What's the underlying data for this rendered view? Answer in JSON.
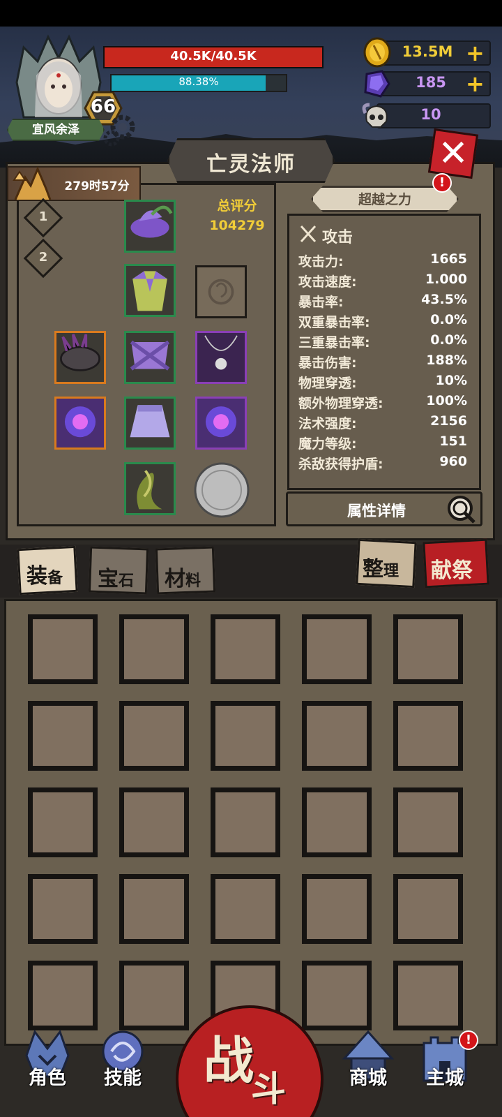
{
  "player": {
    "name": "宜风余泽",
    "level": "66",
    "hp_text": "40.5K/40.5K",
    "hp_fraction": 1.0,
    "exp_text": "88.38%",
    "exp_fraction": 0.8838
  },
  "resources": {
    "gold": "13.5M",
    "crystal": "185",
    "skull_token": "10"
  },
  "title": "亡灵法师",
  "timer": "279时57分",
  "presets": [
    "1",
    "2"
  ],
  "score": {
    "label": "总评分",
    "value": "104279"
  },
  "beyond_power": "超越之力",
  "stats": {
    "header": "攻击",
    "rows": [
      {
        "name": "攻击力:",
        "value": "1665"
      },
      {
        "name": "攻击速度:",
        "value": "1.000"
      },
      {
        "name": "暴击率:",
        "value": "43.5%"
      },
      {
        "name": "双重暴击率:",
        "value": "0.0%"
      },
      {
        "name": "三重暴击率:",
        "value": "0.0%"
      },
      {
        "name": "暴击伤害:",
        "value": "188%"
      },
      {
        "name": "物理穿透:",
        "value": "10%"
      },
      {
        "name": "额外物理穿透:",
        "value": "100%"
      },
      {
        "name": "法术强度:",
        "value": "2156"
      },
      {
        "name": "魔力等级:",
        "value": "151"
      },
      {
        "name": "杀敌获得护盾:",
        "value": "960"
      }
    ]
  },
  "details_button": "属性详情",
  "tabs": {
    "equipment": {
      "big": "装",
      "small": "备"
    },
    "gems": {
      "big": "宝",
      "small": "石"
    },
    "materials": {
      "big": "材",
      "small": "料"
    },
    "sort": {
      "big": "整",
      "small": "理"
    },
    "sacrifice": "献祭"
  },
  "nav": {
    "character": "角色",
    "skills": "技能",
    "battle_big": "战",
    "battle_small": "斗",
    "shop": "商城",
    "main_city": "主城"
  },
  "alert_mark": "!",
  "colors": {
    "hp": "#c8281e",
    "exp": "#19a5b8",
    "gold_text": "#f1cd38",
    "crystal_text": "#c896f2",
    "rare_border": "#2a8a4c",
    "epic_border": "#8a3fb6",
    "legendary_border": "#d97a1e",
    "close_red": "#c7222a"
  }
}
